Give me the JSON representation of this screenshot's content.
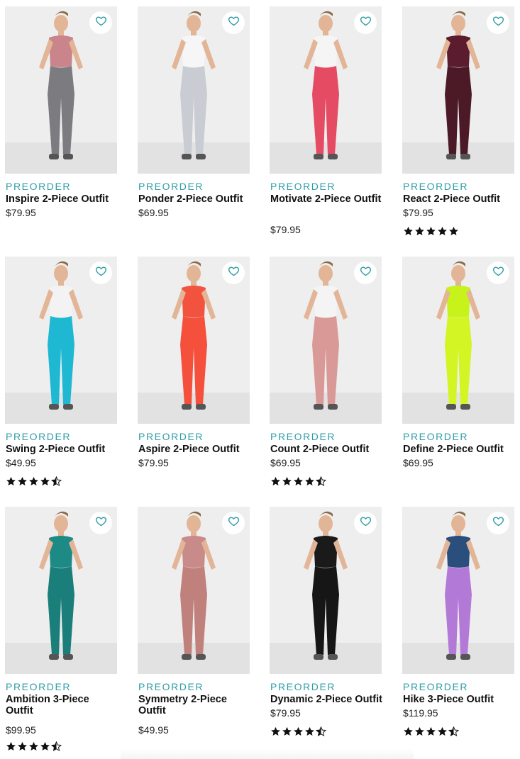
{
  "accent_color": "#2f9da6",
  "products": [
    {
      "badge": "PREORDER",
      "name": "Inspire 2-Piece Outfit",
      "price": "$79.95",
      "rating": null,
      "top": "#c9858b",
      "bottom": "#7b7b80"
    },
    {
      "badge": "PREORDER",
      "name": "Ponder 2-Piece Outfit",
      "price": "$69.95",
      "rating": null,
      "top": "#f6f6f6",
      "bottom": "#c9ccd2"
    },
    {
      "badge": "PREORDER",
      "name": "Motivate 2-Piece Outfit",
      "price": "$79.95",
      "rating": null,
      "top": "#f5f5f5",
      "bottom": "#e54b62"
    },
    {
      "badge": "PREORDER",
      "name": "React 2-Piece Outfit",
      "price": "$79.95",
      "rating": 5,
      "top": "#5a1c2e",
      "bottom": "#4c1a27"
    },
    {
      "badge": "PREORDER",
      "name": "Swing 2-Piece Outfit",
      "price": "$49.95",
      "rating": 4.5,
      "top": "#f3f3f3",
      "bottom": "#1fb8d2"
    },
    {
      "badge": "PREORDER",
      "name": "Aspire 2-Piece Outfit",
      "price": "$79.95",
      "rating": null,
      "top": "#f2533f",
      "bottom": "#f4503c"
    },
    {
      "badge": "PREORDER",
      "name": "Count 2-Piece Outfit",
      "price": "$69.95",
      "rating": 4.5,
      "top": "#f4f4f4",
      "bottom": "#d99996"
    },
    {
      "badge": "PREORDER",
      "name": "Define 2-Piece Outfit",
      "price": "$69.95",
      "rating": null,
      "top": "#c7f21a",
      "bottom": "#d2f523"
    },
    {
      "badge": "PREORDER",
      "name": "Ambition 3-Piece Outfit",
      "price": "$99.95",
      "rating": 4.5,
      "top": "#1e8a85",
      "bottom": "#1a7e7a"
    },
    {
      "badge": "PREORDER",
      "name": "Symmetry 2-Piece Outfit",
      "price": "$49.95",
      "rating": null,
      "top": "#c98a8a",
      "bottom": "#c0807c"
    },
    {
      "badge": "PREORDER",
      "name": "Dynamic 2-Piece Outfit",
      "price": "$79.95",
      "rating": 4.5,
      "top": "#1a1a1a",
      "bottom": "#161616"
    },
    {
      "badge": "PREORDER",
      "name": "Hike 3-Piece Outfit",
      "price": "$119.95",
      "rating": 4.5,
      "top": "#2a4f7c",
      "bottom": "#b27ad6"
    }
  ]
}
